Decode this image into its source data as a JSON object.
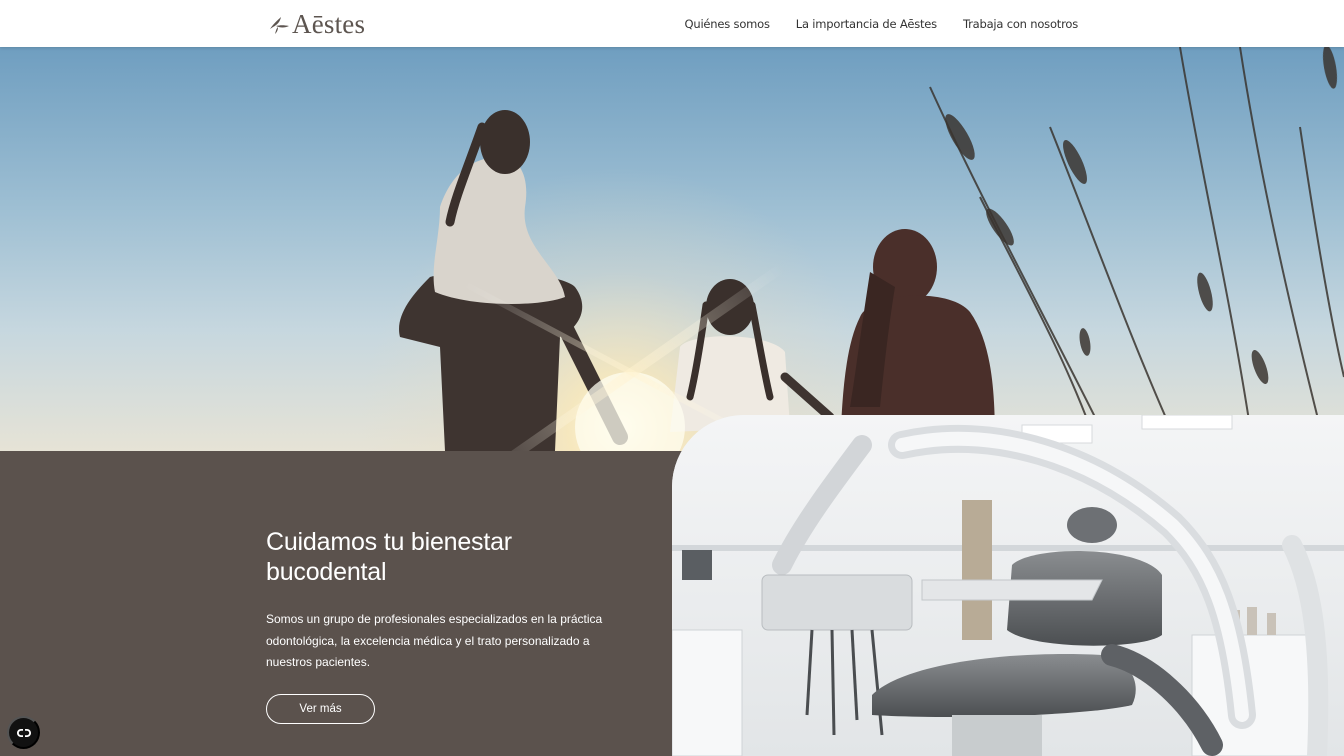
{
  "brand": {
    "name": "Aēstes",
    "logo_icon": "aestes-leaf-icon",
    "color": "#5d5550"
  },
  "nav": {
    "items": [
      {
        "label": "Quiénes somos"
      },
      {
        "label": "La importancia de Aēstes"
      },
      {
        "label": "Trabaja con nosotros"
      }
    ]
  },
  "hero": {
    "image": "family-silhouette-sunset-photo"
  },
  "intro": {
    "headline": "Cuidamos tu bienestar bucodental",
    "description": "Somos un grupo de profesionales especializados en la práctica odontológica, la excelencia médica y el trato personalizado a nuestros pacientes.",
    "cta_label": "Ver más",
    "panel_color": "#5b524d"
  },
  "dental_image": {
    "image": "dental-clinic-chair-photo"
  },
  "accessibility": {
    "icon": "accessibility-toggle-icon"
  }
}
